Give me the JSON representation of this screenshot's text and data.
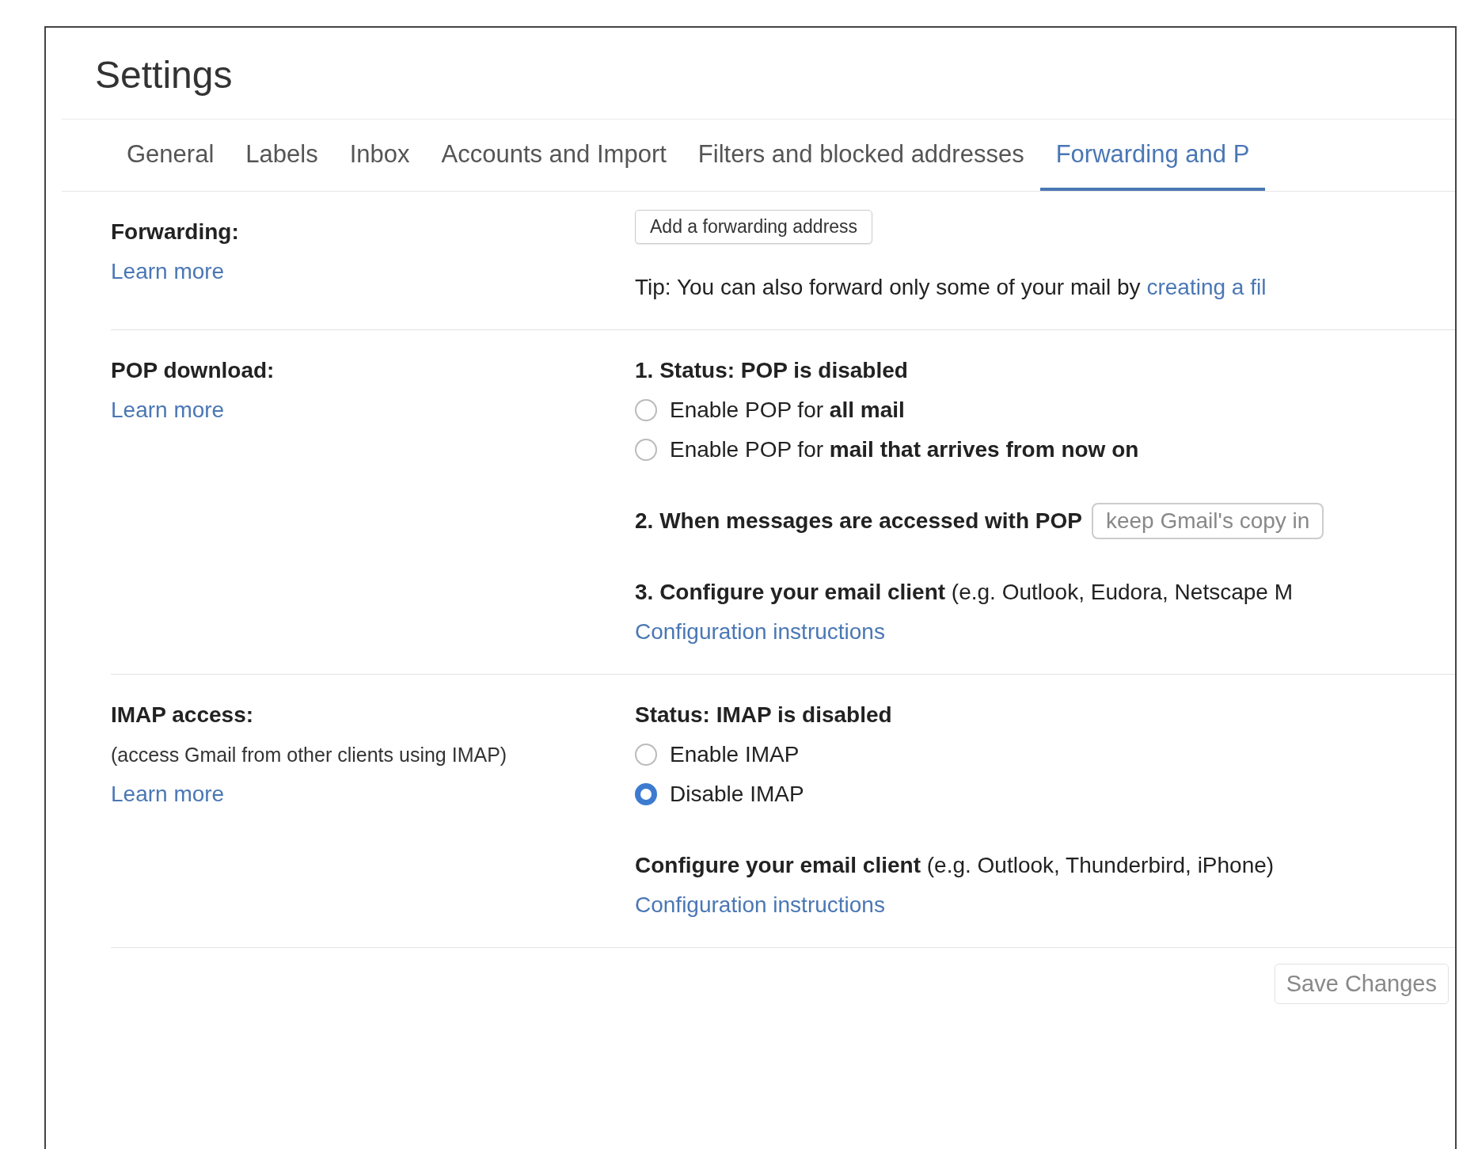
{
  "title": "Settings",
  "tabs": [
    {
      "label": "General",
      "selected": false
    },
    {
      "label": "Labels",
      "selected": false
    },
    {
      "label": "Inbox",
      "selected": false
    },
    {
      "label": "Accounts and Import",
      "selected": false
    },
    {
      "label": "Filters and blocked addresses",
      "selected": false
    },
    {
      "label": "Forwarding and P",
      "selected": true
    }
  ],
  "sections": [
    {
      "label": "Forwarding:",
      "link": "Learn more",
      "content": [
        {
          "kind": "button",
          "text": "Add a forwarding address"
        },
        {
          "kind": "tip",
          "text": "Tip: You can also forward only some of your mail by",
          "link": "creating a fil"
        }
      ]
    },
    {
      "label": "POP download:",
      "link": "Learn more",
      "content": [
        {
          "kind": "heading",
          "text": "1. Status: POP is disabled"
        },
        {
          "kind": "radio",
          "text": "Enable POP for **all mail**",
          "selected": false
        },
        {
          "kind": "radio",
          "text": "Enable POP for **mail that arrives from now on**",
          "selected": false
        },
        {
          "kind": "select",
          "text": "2. When messages are accessed with POP",
          "value": "keep Gmail's copy in"
        },
        {
          "kind": "para",
          "text": "**3. Configure your email client** (e.g. Outlook, Eudora, Netscape M"
        },
        {
          "kind": "link",
          "text": "Configuration instructions"
        }
      ]
    },
    {
      "label": "IMAP access:",
      "note": "(access Gmail from other clients using IMAP)",
      "link": "Learn more",
      "content": [
        {
          "kind": "heading",
          "text": "Status: IMAP is disabled"
        },
        {
          "kind": "radio",
          "text": "Enable IMAP",
          "selected": false
        },
        {
          "kind": "radio",
          "text": "Disable IMAP",
          "selected": true
        },
        {
          "kind": "para",
          "text": "**Configure your email client** (e.g. Outlook, Thunderbird, iPhone)"
        },
        {
          "kind": "link",
          "text": "Configuration instructions"
        }
      ]
    }
  ],
  "save_button": "Save Changes"
}
